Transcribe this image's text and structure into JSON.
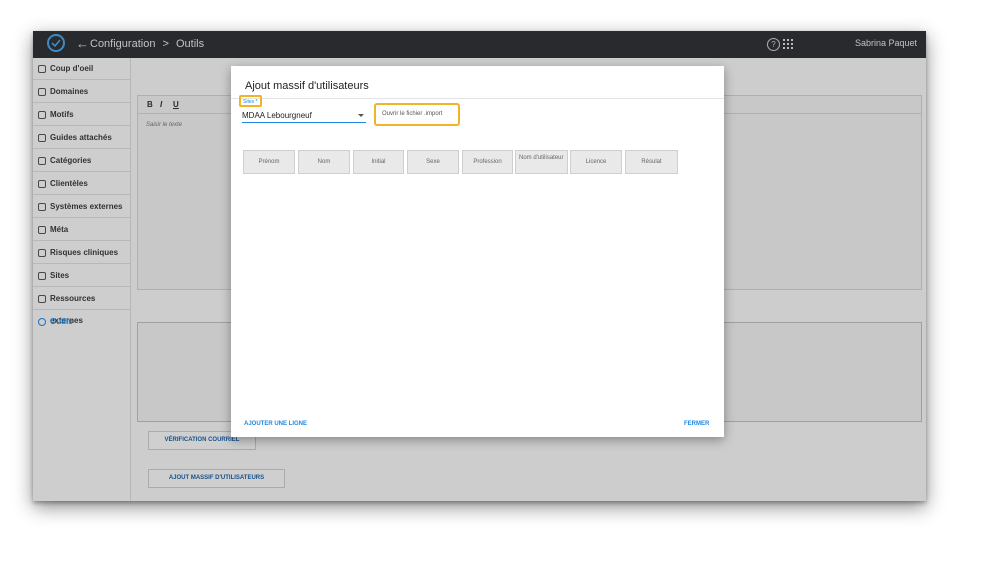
{
  "topbar": {
    "back_icon": "←",
    "breadcrumb": [
      "Configuration",
      ">",
      "Outils"
    ],
    "help_icon": "?",
    "user_name": "Sabrina Paquet"
  },
  "sidebar": {
    "items": [
      {
        "label": "Coup d'oeil",
        "icon": "dashboard-icon"
      },
      {
        "label": "Domaines",
        "icon": "domains-icon"
      },
      {
        "label": "Motifs",
        "icon": "location-icon"
      },
      {
        "label": "Guides attachés",
        "icon": "guide-icon"
      },
      {
        "label": "Catégories",
        "icon": "tag-icon"
      },
      {
        "label": "Clientèles",
        "icon": "people-icon"
      },
      {
        "label": "Systèmes externes",
        "icon": "link-icon"
      },
      {
        "label": "Méta",
        "icon": "meta-icon"
      },
      {
        "label": "Risques cliniques",
        "icon": "heart-icon"
      },
      {
        "label": "Sites",
        "icon": "pin-icon"
      },
      {
        "label": "Ressources externes",
        "icon": "network-icon"
      },
      {
        "label": "Outils",
        "icon": "gear-icon",
        "active": true
      }
    ],
    "collapse_icon": "<"
  },
  "editor": {
    "toolbar": [
      "B",
      "I",
      "U"
    ],
    "placeholder": "Saisir le texte"
  },
  "background_buttons": {
    "email_check": "VÉRIFICATION COURRIEL",
    "bulk_add": "AJOUT MASSIF D'UTILISATEURS"
  },
  "modal": {
    "title": "Ajout massif d'utilisateurs",
    "sites_label": "Sites *",
    "sites_value": "MDAA Lebourgneuf",
    "open_file": "Ouvrir le fichier .import",
    "columns": [
      "Prénom",
      "Nom",
      "Initial",
      "Sexe",
      "Profession",
      "Nom d'utilisateur",
      "Licence",
      "Résulat"
    ],
    "add_row": "AJOUTER UNE LIGNE",
    "close": "FERMER"
  },
  "colors": {
    "topbar": "#2f3237",
    "accent": "#1e88e5",
    "highlight": "#f0b429"
  }
}
